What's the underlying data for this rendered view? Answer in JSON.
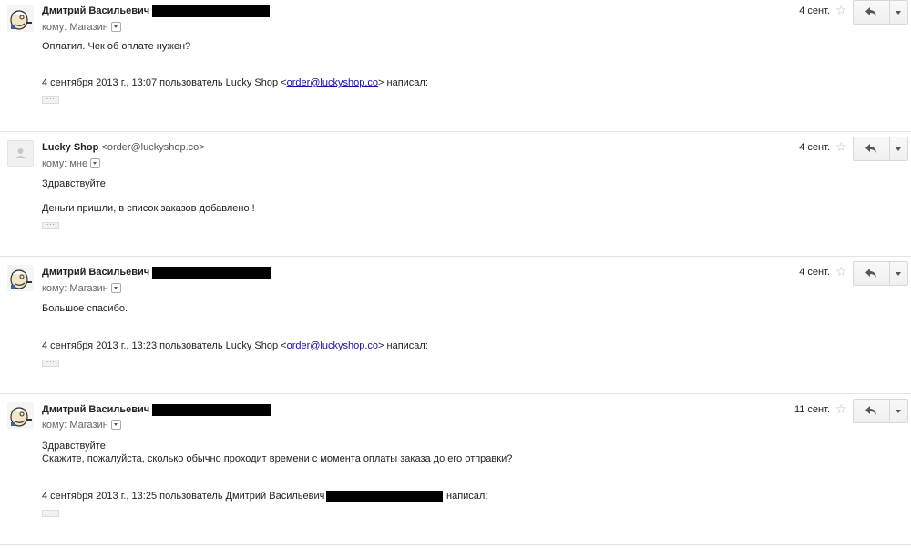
{
  "messages": [
    {
      "sender": "Дмитрий Васильевич",
      "sender_email": "",
      "to_label": "кому: Магазин",
      "date": "4 сент.",
      "body": [
        "Оплатил. Чек об оплате нужен?"
      ],
      "quote_prefix": "4 сентября 2013 г., 13:07 пользователь Lucky Shop <",
      "quote_email": "order@luckyshop.co",
      "quote_suffix": "> написал:",
      "avatar": "popeye-avatar"
    },
    {
      "sender": "Lucky Shop",
      "sender_email": "<order@luckyshop.co>",
      "to_label": "кому: мне",
      "date": "4 сент.",
      "body": [
        "Здравствуйте,",
        "Деньги пришли, в список заказов добавлено !"
      ],
      "avatar": "default-person-avatar"
    },
    {
      "sender": "Дмитрий Васильевич",
      "sender_email": "",
      "to_label": "кому: Магазин",
      "date": "4 сент.",
      "body": [
        "Большое спасибо."
      ],
      "quote_prefix": "4 сентября 2013 г., 13:23 пользователь Lucky Shop <",
      "quote_email": "order@luckyshop.co",
      "quote_suffix": "> написал:",
      "avatar": "popeye-avatar"
    },
    {
      "sender": "Дмитрий Васильевич",
      "sender_email": "",
      "to_label": "кому: Магазин",
      "date": "11 сент.",
      "body": [
        "Здравствуйте!",
        "Скажите, пожалуйста, сколько обычно проходит времени с момента оплаты заказа до его отправки?"
      ],
      "quote_prefix": "4 сентября 2013 г., 13:25 пользователь Дмитрий Васильевич",
      "quote_suffix": "написал:",
      "avatar": "popeye-avatar"
    }
  ],
  "icons": {
    "star": "star-outline-icon",
    "reply": "reply-arrow-icon",
    "more": "chevron-down-icon",
    "ellipsis": "show-trimmed-content-icon"
  },
  "colors": {
    "link": "#1a0dab",
    "redaction": "#000000",
    "divider": "#e3e3e3"
  }
}
